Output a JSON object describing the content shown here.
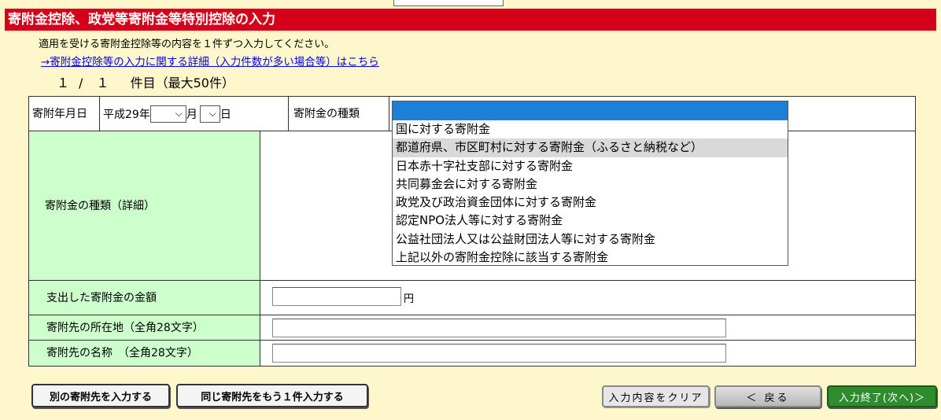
{
  "title": "寄附金控除、政党等寄附金等特別控除の入力",
  "instruction": "適用を受ける寄附金控除等の内容を１件ずつ入力してください。",
  "detail_link": "→寄附金控除等の入力に関する詳細（入力件数が多い場合等）はこちら",
  "counter": {
    "current": "１",
    "sep": "/",
    "total": "１",
    "suffix": "件目（最大50件）"
  },
  "form": {
    "date_label": "寄附年月日",
    "era_year": "平成29年",
    "month_unit": "月",
    "day_unit": "日",
    "type_label": "寄附金の種類",
    "detail_label": "寄附金の種類（詳細）",
    "amount_label": "支出した寄附金の金額",
    "amount_value": "",
    "amount_unit": "円",
    "address_label": "寄附先の所在地（全角28文字）",
    "address_value": "",
    "name_label": "寄附先の名称　（全角28文字）",
    "name_value": ""
  },
  "dropdown": {
    "selected_index": 1,
    "options": [
      "国に対する寄附金",
      "都道府県、市区町村に対する寄附金（ふるさと納税など）",
      "日本赤十字社支部に対する寄附金",
      "共同募金会に対する寄附金",
      "政党及び政治資金団体に対する寄附金",
      "認定NPO法人等に対する寄附金",
      "公益社団法人又は公益財団法人等に対する寄附金",
      "上記以外の寄附金控除に該当する寄附金"
    ]
  },
  "buttons": {
    "other_recipient": "別の寄附先を入力する",
    "same_recipient": "同じ寄附先をもう１件入力する",
    "clear": "入力内容をクリア",
    "back": "＜ 戻る",
    "finish": "入力終了(次へ)＞"
  },
  "colors": {
    "title_bg": "#d7001a",
    "page_bg": "#fff7cc",
    "label_bg": "#ccffcc",
    "dropdown_highlight": "#1e7fd6"
  }
}
